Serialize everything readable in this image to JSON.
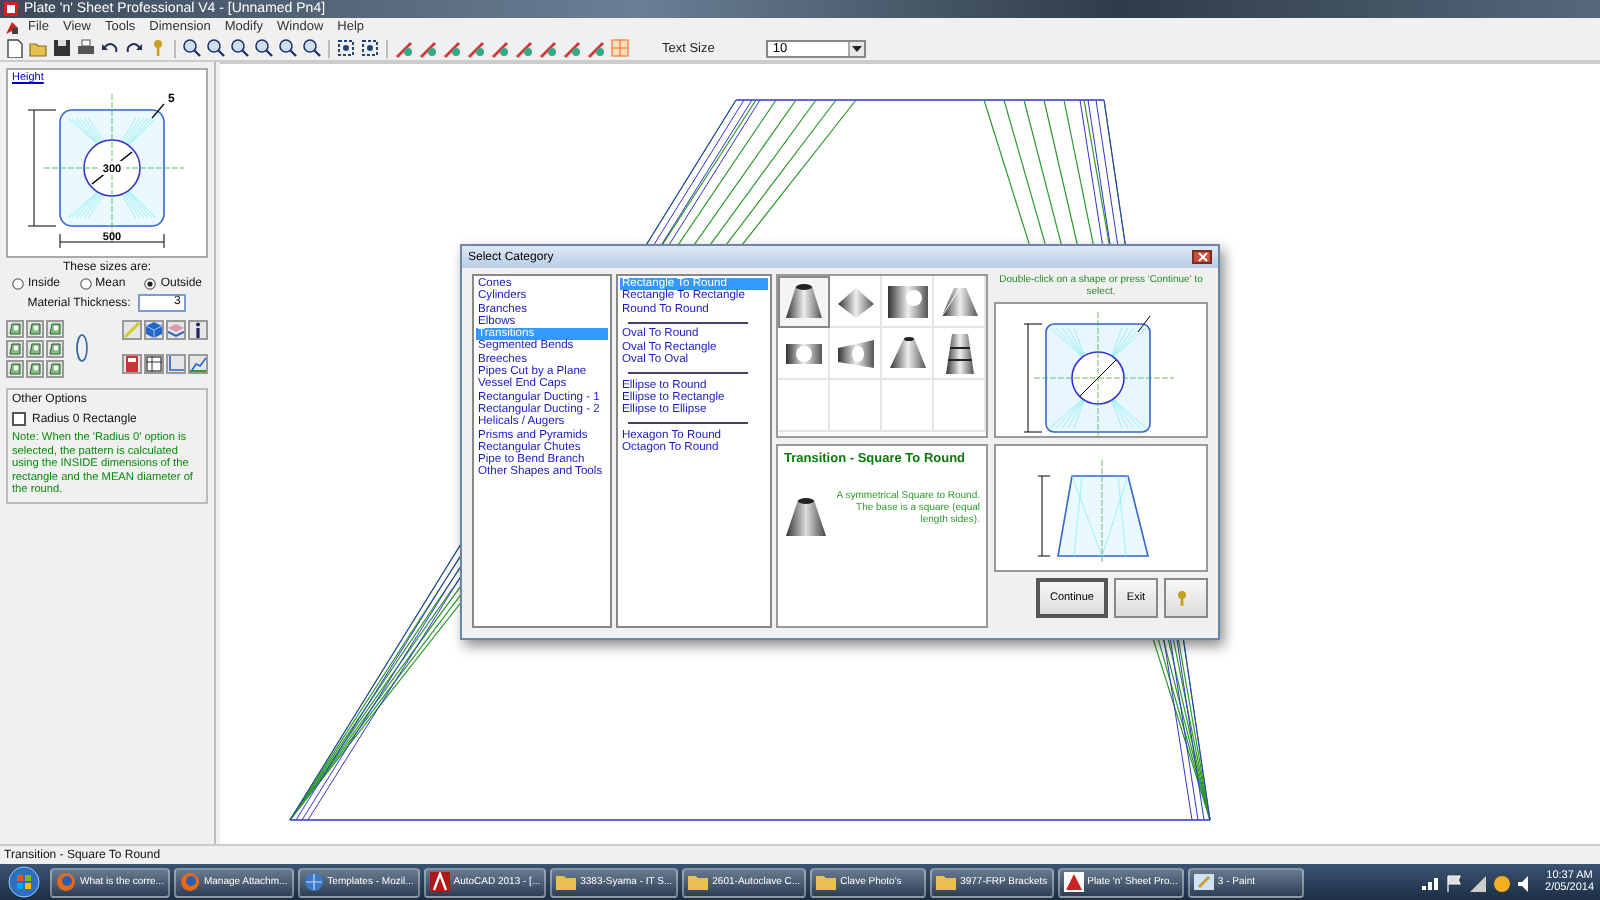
{
  "window": {
    "title": "Plate 'n' Sheet Professional V4 - [Unnamed Pn4]"
  },
  "menu": [
    "File",
    "View",
    "Tools",
    "Dimension",
    "Modify",
    "Window",
    "Help"
  ],
  "toolbar": {
    "text_size_label": "Text Size",
    "text_size_value": "10"
  },
  "side_panel": {
    "diagram": {
      "link": "Height",
      "labels": [
        "5",
        "300",
        "500"
      ]
    },
    "sizes_label": "These sizes are:",
    "size_options": [
      {
        "label": "Inside",
        "selected": false
      },
      {
        "label": "Mean",
        "selected": false
      },
      {
        "label": "Outside",
        "selected": true
      }
    ],
    "thickness_label": "Material Thickness:",
    "thickness_value": "3",
    "other_options": {
      "title": "Other Options",
      "checkbox": {
        "label": "Radius 0 Rectangle",
        "checked": false
      },
      "note": "Note:  When the 'Radius 0' option is selected, the pattern is calculated using the INSIDE dimensions of the rectangle and the MEAN diameter of the round."
    }
  },
  "dialog": {
    "title": "Select Category",
    "categories": [
      {
        "label": "Cones",
        "selected": false
      },
      {
        "label": "Cylinders",
        "selected": false
      },
      {
        "label": "Branches",
        "selected": false
      },
      {
        "label": "Elbows",
        "selected": false
      },
      {
        "label": "Transitions",
        "selected": true
      },
      {
        "label": "Segmented Bends",
        "selected": false
      },
      {
        "label": "Breeches",
        "selected": false
      },
      {
        "label": "Pipes Cut by a Plane",
        "selected": false
      },
      {
        "label": "Vessel End Caps",
        "selected": false
      },
      {
        "label": "Rectangular Ducting - 1",
        "selected": false
      },
      {
        "label": "Rectangular Ducting - 2",
        "selected": false
      },
      {
        "label": "Helicals / Augers",
        "selected": false
      },
      {
        "label": "Prisms and Pyramids",
        "selected": false
      },
      {
        "label": "Rectangular Chutes",
        "selected": false
      },
      {
        "label": "Pipe to Bend Branch",
        "selected": false
      },
      {
        "label": "Other Shapes and Tools",
        "selected": false
      }
    ],
    "shapes": [
      {
        "kind": "item",
        "label": "Rectangle To Round",
        "selected": true
      },
      {
        "kind": "item",
        "label": "Rectangle To Rectangle",
        "selected": false
      },
      {
        "kind": "item",
        "label": "Round To Round",
        "selected": false
      },
      {
        "kind": "separator"
      },
      {
        "kind": "item",
        "label": "Oval To Round",
        "selected": false
      },
      {
        "kind": "item",
        "label": "Oval To Rectangle",
        "selected": false
      },
      {
        "kind": "item",
        "label": "Oval To Oval",
        "selected": false
      },
      {
        "kind": "separator"
      },
      {
        "kind": "item",
        "label": "Ellipse to Round",
        "selected": false
      },
      {
        "kind": "item",
        "label": "Ellipse to Rectangle",
        "selected": false
      },
      {
        "kind": "item",
        "label": "Ellipse to Ellipse",
        "selected": false
      },
      {
        "kind": "separator"
      },
      {
        "kind": "item",
        "label": "Hexagon To Round",
        "selected": false
      },
      {
        "kind": "item",
        "label": "Octagon To Round",
        "selected": false
      }
    ],
    "gallery": [
      {
        "selected": true
      },
      {
        "selected": false
      },
      {
        "selected": false
      },
      {
        "selected": false
      },
      {
        "selected": false
      },
      {
        "selected": false
      },
      {
        "selected": false
      },
      {
        "selected": false
      }
    ],
    "hint": "Double-click on a shape or press 'Continue' to select.",
    "description": {
      "title": "Transition - Square To Round",
      "text": "A symmetrical Square to Round. The base is a square (equal length sides)."
    },
    "buttons": [
      "Continue",
      "Exit"
    ]
  },
  "status_bar": "Transition - Square To Round",
  "taskbar": {
    "items": [
      {
        "kind": "browser",
        "label": "What is the corre..."
      },
      {
        "kind": "browser",
        "label": "Manage Attachm..."
      },
      {
        "kind": "mail",
        "label": "Templates - Mozil..."
      },
      {
        "kind": "cad",
        "label": "AutoCAD 2013 - [..."
      },
      {
        "kind": "folder",
        "label": "3383-Syama - IT S..."
      },
      {
        "kind": "folder",
        "label": "2601-Autoclave C..."
      },
      {
        "kind": "folder",
        "label": "Clave Photo's"
      },
      {
        "kind": "folder",
        "label": "3977-FRP Brackets"
      },
      {
        "kind": "app",
        "label": "Plate 'n' Sheet Pro..."
      },
      {
        "kind": "paint",
        "label": "3 - Paint"
      }
    ],
    "clock": {
      "time": "10:37 AM",
      "date": "2/05/2014"
    }
  }
}
